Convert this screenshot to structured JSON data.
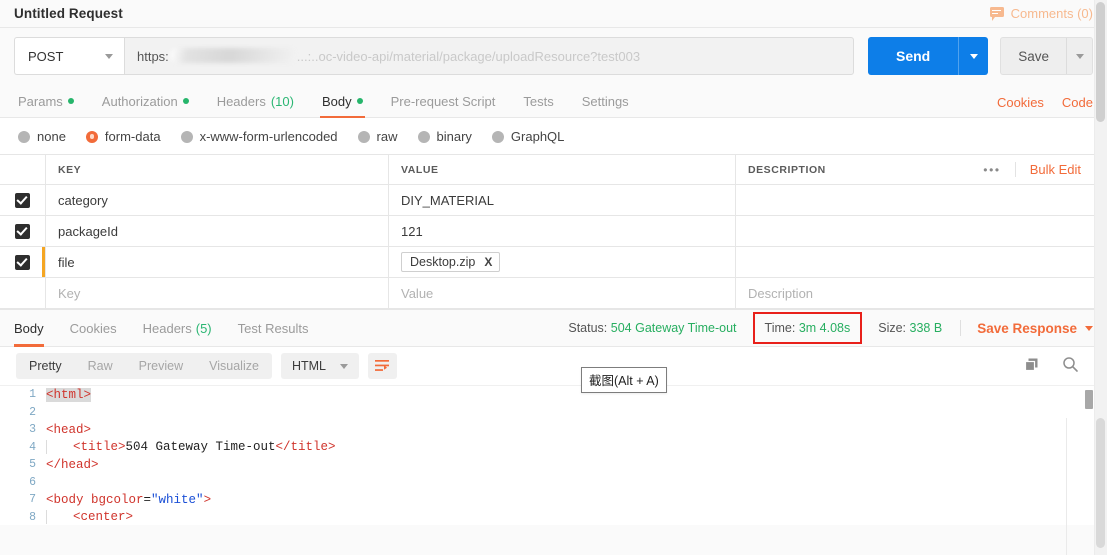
{
  "window": {
    "request_title": "Untitled Request",
    "comments_label": "Comments (0)",
    "comments_icon": "comment-icon"
  },
  "request": {
    "method": "POST",
    "url_prefix": "https:",
    "url_redacted": "[blurred host]",
    "url_suffix": "...:..oc-video-api/material/package/uploadResource?test003",
    "send_label": "Send",
    "save_label": "Save"
  },
  "request_tabs": [
    {
      "label": "Params",
      "dot": true,
      "count": "",
      "active": false
    },
    {
      "label": "Authorization",
      "dot": true,
      "count": "",
      "active": false
    },
    {
      "label": "Headers",
      "dot": false,
      "count": "(10)",
      "active": false
    },
    {
      "label": "Body",
      "dot": true,
      "count": "",
      "active": true
    },
    {
      "label": "Pre-request Script",
      "dot": false,
      "count": "",
      "active": false
    },
    {
      "label": "Tests",
      "dot": false,
      "count": "",
      "active": false
    },
    {
      "label": "Settings",
      "dot": false,
      "count": "",
      "active": false
    }
  ],
  "request_tabs_right": [
    {
      "label": "Cookies"
    },
    {
      "label": "Code"
    }
  ],
  "body_types": [
    {
      "label": "none",
      "selected": false
    },
    {
      "label": "form-data",
      "selected": true
    },
    {
      "label": "x-www-form-urlencoded",
      "selected": false
    },
    {
      "label": "raw",
      "selected": false
    },
    {
      "label": "binary",
      "selected": false
    },
    {
      "label": "GraphQL",
      "selected": false
    }
  ],
  "kv_table": {
    "headers": {
      "key": "KEY",
      "value": "VALUE",
      "description": "DESCRIPTION"
    },
    "options_icon": "ellipsis-icon",
    "bulk_edit": "Bulk Edit",
    "rows": [
      {
        "checked": true,
        "key": "category",
        "value": "DIY_MATERIAL",
        "description": "",
        "is_file": false
      },
      {
        "checked": true,
        "key": "packageId",
        "value": "121",
        "description": "",
        "is_file": false
      },
      {
        "checked": true,
        "key": "file",
        "value": "Desktop.zip",
        "description": "",
        "is_file": true,
        "remove_label": "X"
      }
    ],
    "placeholder_row": {
      "key": "Key",
      "value": "Value",
      "description": "Description"
    }
  },
  "response_tabs": [
    {
      "label": "Body",
      "count": "",
      "active": true
    },
    {
      "label": "Cookies",
      "count": "",
      "active": false
    },
    {
      "label": "Headers",
      "count": "(5)",
      "active": false
    },
    {
      "label": "Test Results",
      "count": "",
      "active": false
    }
  ],
  "response_status": {
    "status_label": "Status:",
    "status_value": "504 Gateway Time-out",
    "time_label": "Time:",
    "time_value": "3m 4.08s",
    "size_label": "Size:",
    "size_value": "338 B",
    "save_response": "Save Response",
    "highlight_color": "#e8201a",
    "value_color": "#27ae60"
  },
  "tooltip": {
    "text": "截图(Alt + A)"
  },
  "viewer": {
    "segments": [
      {
        "label": "Pretty",
        "active": true
      },
      {
        "label": "Raw",
        "active": false
      },
      {
        "label": "Preview",
        "active": false
      },
      {
        "label": "Visualize",
        "active": false
      }
    ],
    "format": "HTML",
    "wrap_icon": "word-wrap-icon",
    "copy_icon": "copy-icon",
    "search_icon": "search-icon"
  },
  "code": {
    "lines": [
      {
        "n": "1",
        "tokens": [
          {
            "t": "tag",
            "s": "<html>",
            "sel": true
          }
        ]
      },
      {
        "n": "2",
        "tokens": []
      },
      {
        "n": "3",
        "tokens": [
          {
            "t": "tag",
            "s": "<head>"
          }
        ]
      },
      {
        "n": "4",
        "indent": 1,
        "tokens": [
          {
            "t": "tag",
            "s": "<title>"
          },
          {
            "t": "txt",
            "s": "504 Gateway Time-out"
          },
          {
            "t": "tag",
            "s": "</title>"
          }
        ]
      },
      {
        "n": "5",
        "tokens": [
          {
            "t": "tag",
            "s": "</head>"
          }
        ]
      },
      {
        "n": "6",
        "tokens": []
      },
      {
        "n": "7",
        "tokens": [
          {
            "t": "tag",
            "s": "<body "
          },
          {
            "t": "attr",
            "s": "bgcolor"
          },
          {
            "t": "txt",
            "s": "="
          },
          {
            "t": "val",
            "s": "\"white\""
          },
          {
            "t": "tag",
            "s": ">"
          }
        ]
      },
      {
        "n": "8",
        "indent": 1,
        "tokens": [
          {
            "t": "tag",
            "s": "<center>"
          }
        ]
      }
    ]
  }
}
